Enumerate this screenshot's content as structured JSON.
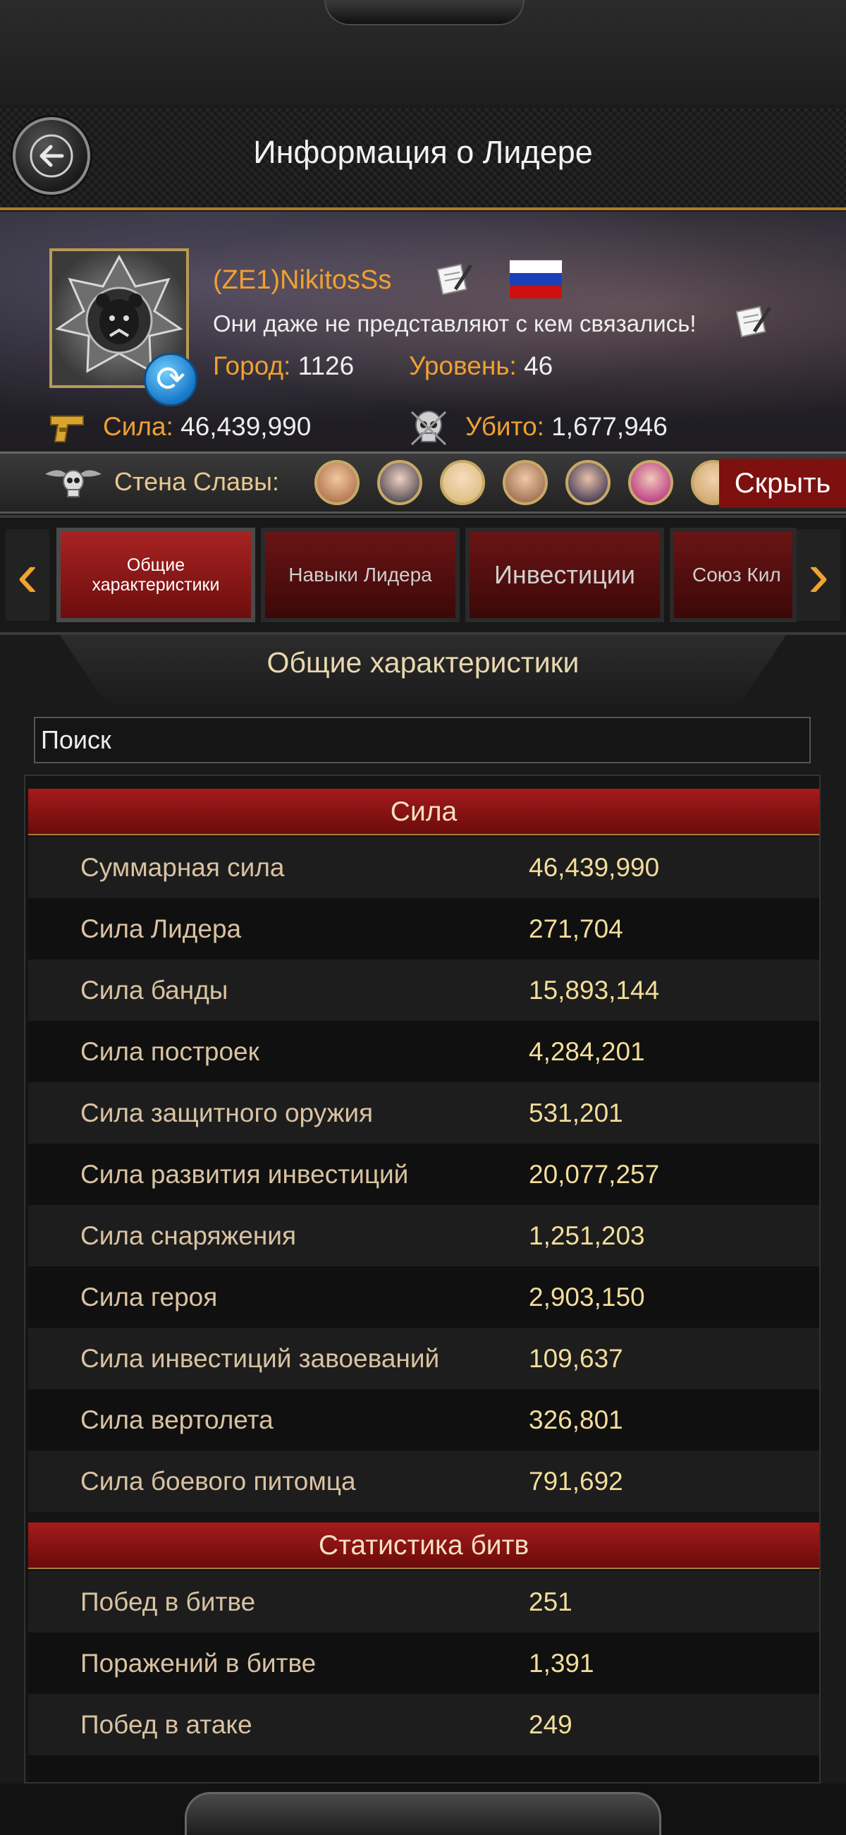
{
  "header": {
    "title": "Информация о Лидере"
  },
  "profile": {
    "name": "(ZE1)NikitosSs",
    "motto": "Они даже не представляют с кем связались!",
    "city_label": "Город:",
    "city_value": "1126",
    "level_label": "Уровень:",
    "level_value": "46",
    "power_label": "Сила:",
    "power_value": "46,439,990",
    "kills_label": "Убито:",
    "kills_value": "1,677,946",
    "flag": "russia-flag"
  },
  "fame": {
    "label": "Стена Славы:",
    "hide_label": "Скрыть"
  },
  "tabs": [
    {
      "label": "Общие характеристики",
      "active": true
    },
    {
      "label": "Навыки Лидера",
      "active": false
    },
    {
      "label": "Инвестиции",
      "active": false
    },
    {
      "label": "Союз Кил",
      "active": false
    }
  ],
  "section": {
    "title": "Общие характеристики",
    "search_placeholder": "Поиск"
  },
  "groups": {
    "power": {
      "title": "Сила",
      "rows": [
        {
          "label": "Суммарная сила",
          "value": "46,439,990"
        },
        {
          "label": "Сила Лидера",
          "value": "271,704"
        },
        {
          "label": "Сила банды",
          "value": "15,893,144"
        },
        {
          "label": "Сила построек",
          "value": "4,284,201"
        },
        {
          "label": "Сила защитного оружия",
          "value": "531,201"
        },
        {
          "label": "Сила развития инвестиций",
          "value": "20,077,257"
        },
        {
          "label": "Сила снаряжения",
          "value": "1,251,203"
        },
        {
          "label": "Сила героя",
          "value": "2,903,150"
        },
        {
          "label": "Сила инвестиций завоеваний",
          "value": "109,637"
        },
        {
          "label": "Сила вертолета",
          "value": "326,801"
        },
        {
          "label": "Сила боевого питомца",
          "value": "791,692"
        }
      ]
    },
    "battle": {
      "title": "Статистика битв",
      "rows": [
        {
          "label": "Побед в битве",
          "value": "251"
        },
        {
          "label": "Поражений в битве",
          "value": "1,391"
        },
        {
          "label": "Побед в атаке",
          "value": "249"
        }
      ]
    }
  },
  "colors": {
    "accent": "#f0a030",
    "header_red": "#a51b1b",
    "value_gold": "#f3dd9a"
  }
}
